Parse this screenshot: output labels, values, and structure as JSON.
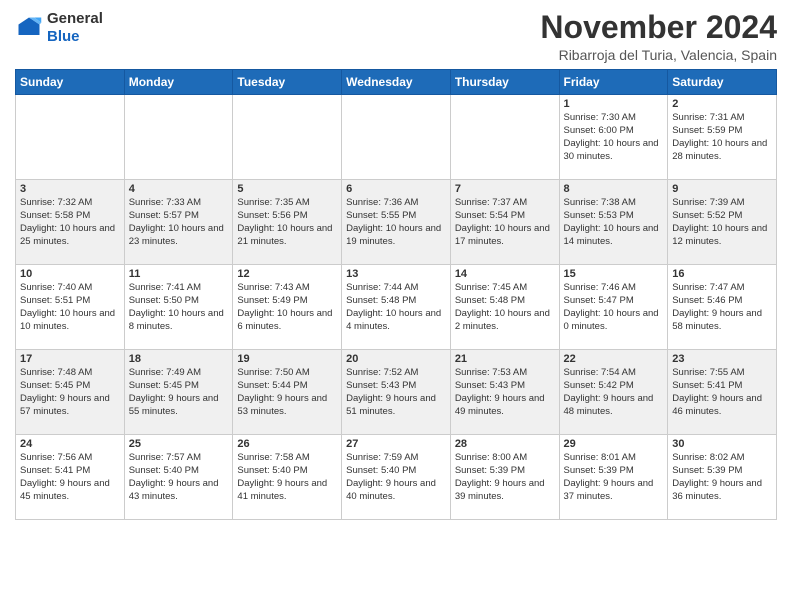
{
  "header": {
    "logo_general": "General",
    "logo_blue": "Blue",
    "month_title": "November 2024",
    "location": "Ribarroja del Turia, Valencia, Spain"
  },
  "weekdays": [
    "Sunday",
    "Monday",
    "Tuesday",
    "Wednesday",
    "Thursday",
    "Friday",
    "Saturday"
  ],
  "weeks": [
    [
      {
        "day": "",
        "info": ""
      },
      {
        "day": "",
        "info": ""
      },
      {
        "day": "",
        "info": ""
      },
      {
        "day": "",
        "info": ""
      },
      {
        "day": "",
        "info": ""
      },
      {
        "day": "1",
        "info": "Sunrise: 7:30 AM\nSunset: 6:00 PM\nDaylight: 10 hours and 30 minutes."
      },
      {
        "day": "2",
        "info": "Sunrise: 7:31 AM\nSunset: 5:59 PM\nDaylight: 10 hours and 28 minutes."
      }
    ],
    [
      {
        "day": "3",
        "info": "Sunrise: 7:32 AM\nSunset: 5:58 PM\nDaylight: 10 hours and 25 minutes."
      },
      {
        "day": "4",
        "info": "Sunrise: 7:33 AM\nSunset: 5:57 PM\nDaylight: 10 hours and 23 minutes."
      },
      {
        "day": "5",
        "info": "Sunrise: 7:35 AM\nSunset: 5:56 PM\nDaylight: 10 hours and 21 minutes."
      },
      {
        "day": "6",
        "info": "Sunrise: 7:36 AM\nSunset: 5:55 PM\nDaylight: 10 hours and 19 minutes."
      },
      {
        "day": "7",
        "info": "Sunrise: 7:37 AM\nSunset: 5:54 PM\nDaylight: 10 hours and 17 minutes."
      },
      {
        "day": "8",
        "info": "Sunrise: 7:38 AM\nSunset: 5:53 PM\nDaylight: 10 hours and 14 minutes."
      },
      {
        "day": "9",
        "info": "Sunrise: 7:39 AM\nSunset: 5:52 PM\nDaylight: 10 hours and 12 minutes."
      }
    ],
    [
      {
        "day": "10",
        "info": "Sunrise: 7:40 AM\nSunset: 5:51 PM\nDaylight: 10 hours and 10 minutes."
      },
      {
        "day": "11",
        "info": "Sunrise: 7:41 AM\nSunset: 5:50 PM\nDaylight: 10 hours and 8 minutes."
      },
      {
        "day": "12",
        "info": "Sunrise: 7:43 AM\nSunset: 5:49 PM\nDaylight: 10 hours and 6 minutes."
      },
      {
        "day": "13",
        "info": "Sunrise: 7:44 AM\nSunset: 5:48 PM\nDaylight: 10 hours and 4 minutes."
      },
      {
        "day": "14",
        "info": "Sunrise: 7:45 AM\nSunset: 5:48 PM\nDaylight: 10 hours and 2 minutes."
      },
      {
        "day": "15",
        "info": "Sunrise: 7:46 AM\nSunset: 5:47 PM\nDaylight: 10 hours and 0 minutes."
      },
      {
        "day": "16",
        "info": "Sunrise: 7:47 AM\nSunset: 5:46 PM\nDaylight: 9 hours and 58 minutes."
      }
    ],
    [
      {
        "day": "17",
        "info": "Sunrise: 7:48 AM\nSunset: 5:45 PM\nDaylight: 9 hours and 57 minutes."
      },
      {
        "day": "18",
        "info": "Sunrise: 7:49 AM\nSunset: 5:45 PM\nDaylight: 9 hours and 55 minutes."
      },
      {
        "day": "19",
        "info": "Sunrise: 7:50 AM\nSunset: 5:44 PM\nDaylight: 9 hours and 53 minutes."
      },
      {
        "day": "20",
        "info": "Sunrise: 7:52 AM\nSunset: 5:43 PM\nDaylight: 9 hours and 51 minutes."
      },
      {
        "day": "21",
        "info": "Sunrise: 7:53 AM\nSunset: 5:43 PM\nDaylight: 9 hours and 49 minutes."
      },
      {
        "day": "22",
        "info": "Sunrise: 7:54 AM\nSunset: 5:42 PM\nDaylight: 9 hours and 48 minutes."
      },
      {
        "day": "23",
        "info": "Sunrise: 7:55 AM\nSunset: 5:41 PM\nDaylight: 9 hours and 46 minutes."
      }
    ],
    [
      {
        "day": "24",
        "info": "Sunrise: 7:56 AM\nSunset: 5:41 PM\nDaylight: 9 hours and 45 minutes."
      },
      {
        "day": "25",
        "info": "Sunrise: 7:57 AM\nSunset: 5:40 PM\nDaylight: 9 hours and 43 minutes."
      },
      {
        "day": "26",
        "info": "Sunrise: 7:58 AM\nSunset: 5:40 PM\nDaylight: 9 hours and 41 minutes."
      },
      {
        "day": "27",
        "info": "Sunrise: 7:59 AM\nSunset: 5:40 PM\nDaylight: 9 hours and 40 minutes."
      },
      {
        "day": "28",
        "info": "Sunrise: 8:00 AM\nSunset: 5:39 PM\nDaylight: 9 hours and 39 minutes."
      },
      {
        "day": "29",
        "info": "Sunrise: 8:01 AM\nSunset: 5:39 PM\nDaylight: 9 hours and 37 minutes."
      },
      {
        "day": "30",
        "info": "Sunrise: 8:02 AM\nSunset: 5:39 PM\nDaylight: 9 hours and 36 minutes."
      }
    ]
  ]
}
